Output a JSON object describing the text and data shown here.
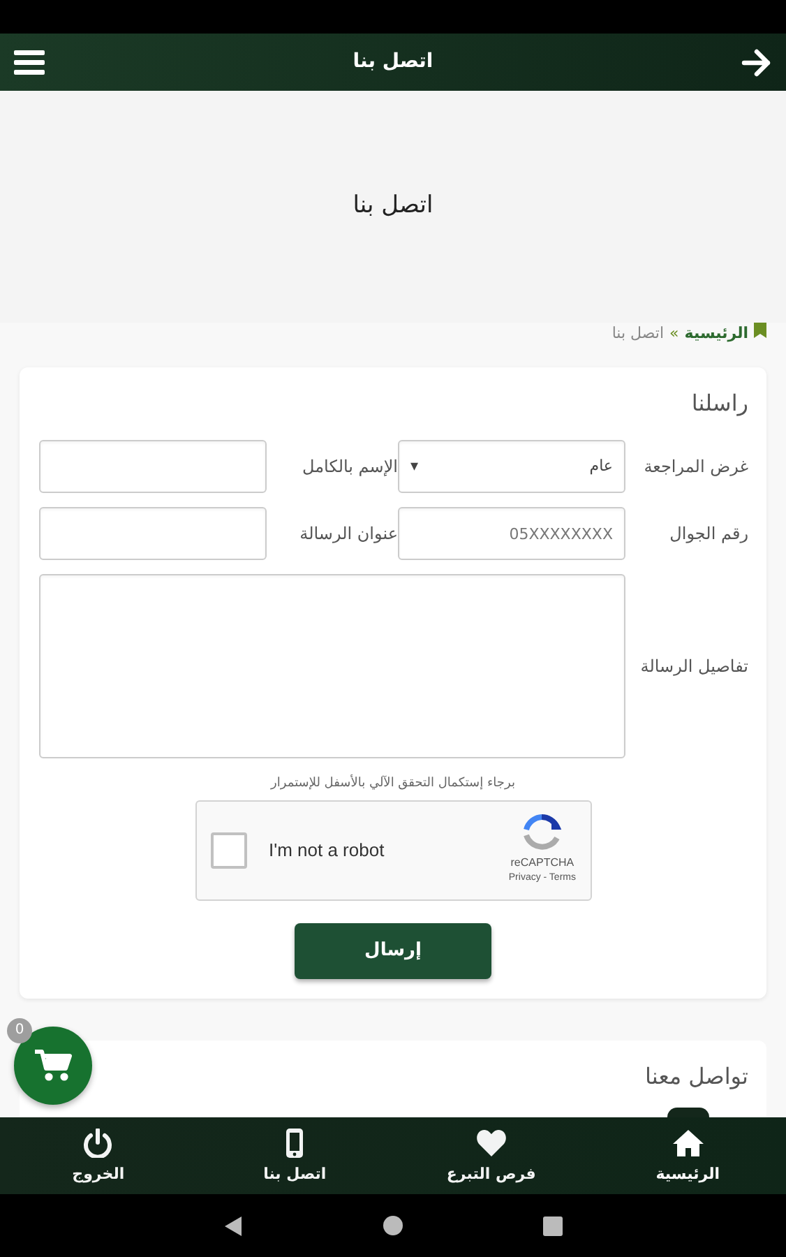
{
  "app_bar": {
    "title": "اتصل بنا"
  },
  "hero": {
    "title": "اتصل بنا"
  },
  "breadcrumb": {
    "separator": "»",
    "items": [
      {
        "label": "الرئيسية",
        "kind": "link"
      },
      {
        "label": "اتصل بنا",
        "kind": "current"
      }
    ]
  },
  "contact_form": {
    "title": "راسلنا",
    "fields": [
      {
        "label": "غرض المراجعة",
        "kind": "select",
        "value": "عام",
        "arrow": "▾"
      },
      {
        "label": "الإسم بالكامل",
        "kind": "text"
      },
      {
        "label": "رقم الجوال",
        "kind": "text",
        "placeholder": "05XXXXXXXX"
      },
      {
        "label": "عنوان الرسالة",
        "kind": "text"
      },
      {
        "label": "تفاصيل الرسالة",
        "kind": "textarea"
      }
    ],
    "captcha_note": "برجاء إستكمال التحقق الآلي بالأسفل للإستمرار",
    "captcha": {
      "label": "I'm not a robot",
      "checked": false,
      "brand": "reCAPTCHA",
      "links": "Privacy - Terms"
    },
    "submit": "إرسال"
  },
  "social_card": {
    "title": "تواصل معنا"
  },
  "cart": {
    "count": "0"
  },
  "bottom_nav": [
    {
      "label": "الرئيسية",
      "kind": "home",
      "selected": true
    },
    {
      "label": "فرص التبرع",
      "kind": "donate",
      "selected": false
    },
    {
      "label": "اتصل بنا",
      "kind": "contact",
      "selected": false
    },
    {
      "label": "الخروج",
      "kind": "logout",
      "selected": false
    }
  ]
}
